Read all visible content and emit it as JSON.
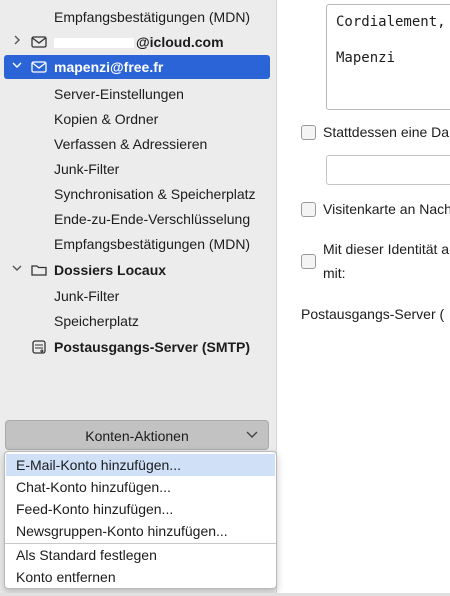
{
  "sidebar": {
    "top_item": "Empfangsbestätigungen (MDN)",
    "icloud_account": "@icloud.com",
    "free_account": {
      "label": "mapenzi@free.fr",
      "children": [
        "Server-Einstellungen",
        "Kopien & Ordner",
        "Verfassen & Adressieren",
        "Junk-Filter",
        "Synchronisation & Speicherplatz",
        "Ende-zu-Ende-Verschlüsselung",
        "Empfangsbestätigungen (MDN)"
      ]
    },
    "local_folders": {
      "label": "Dossiers Locaux",
      "children": [
        "Junk-Filter",
        "Speicherplatz"
      ]
    },
    "smtp": "Postausgangs-Server (SMTP)"
  },
  "account_actions": {
    "button_label": "Konten-Aktionen",
    "menu_items": [
      "E-Mail-Konto hinzufügen...",
      "Chat-Konto hinzufügen...",
      "Feed-Konto hinzufügen...",
      "Newsgruppen-Konto hinzufügen...",
      "Als Standard festlegen",
      "Konto entfernen"
    ],
    "highlighted_item": "E-Mail-Konto hinzufügen..."
  },
  "content": {
    "signature_line1": "Cordialement,",
    "signature_line2": "Mapenzi",
    "opt_file": "Stattdessen eine Da",
    "opt_vcard": "Visitenkarte an Nach",
    "opt_identity_line1": "Mit dieser Identität a",
    "opt_identity_line2": "mit:",
    "smtp_label": "Postausgangs-Server ("
  },
  "colors": {
    "selection": "#2b64d6",
    "sidebar_bg": "#ececec",
    "menu_hover": "#cfe0f7"
  }
}
